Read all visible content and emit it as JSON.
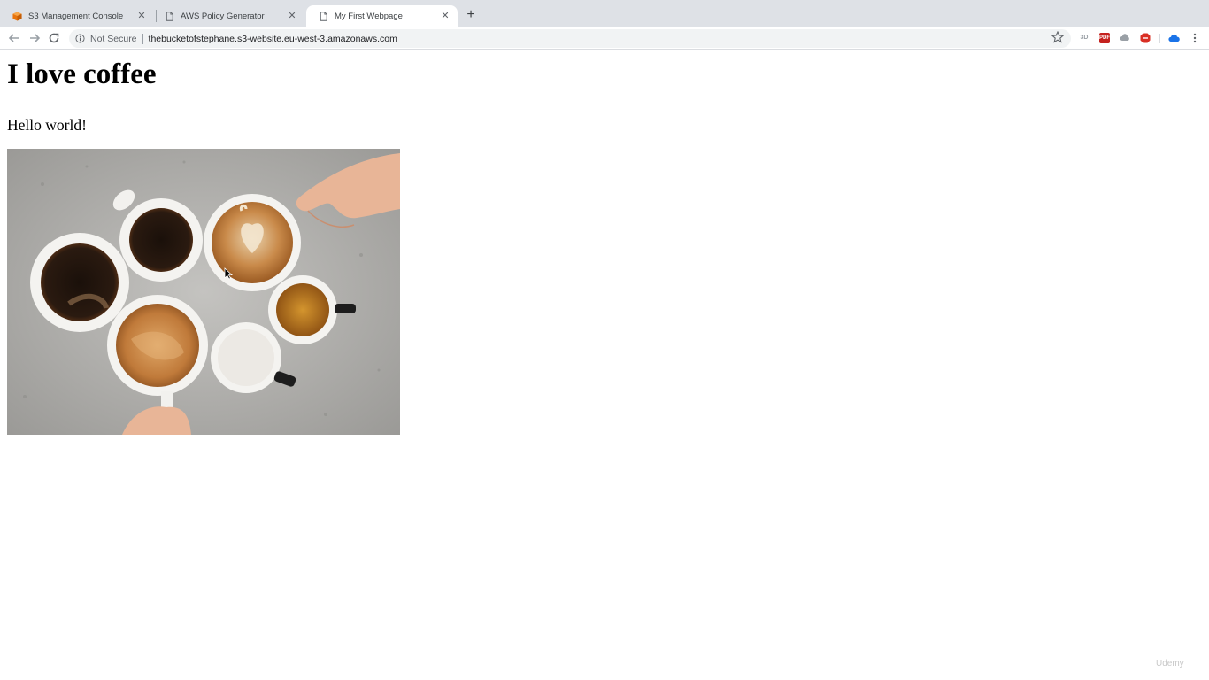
{
  "tabs": [
    {
      "title": "S3 Management Console",
      "icon": "aws-cube-icon",
      "active": false
    },
    {
      "title": "AWS Policy Generator",
      "icon": "document-icon",
      "active": false
    },
    {
      "title": "My First Webpage",
      "icon": "document-icon",
      "active": true
    }
  ],
  "omnibox": {
    "security_label": "Not Secure",
    "url": "thebucketofstephane.s3-website.eu-west-3.amazonaws.com"
  },
  "extensions": [
    "extension-3d-icon",
    "extension-pdf-icon",
    "extension-cloud-icon",
    "extension-adblock-icon",
    "extension-onedrive-icon"
  ],
  "page": {
    "heading": "I love coffee",
    "paragraph": "Hello world!",
    "image_alt": "cups of coffee on concrete table"
  },
  "watermark": "Udemy",
  "colors": {
    "tab_bar": "#dee1e6",
    "omnibox": "#f1f3f4",
    "aws_orange": "#e8740c"
  }
}
